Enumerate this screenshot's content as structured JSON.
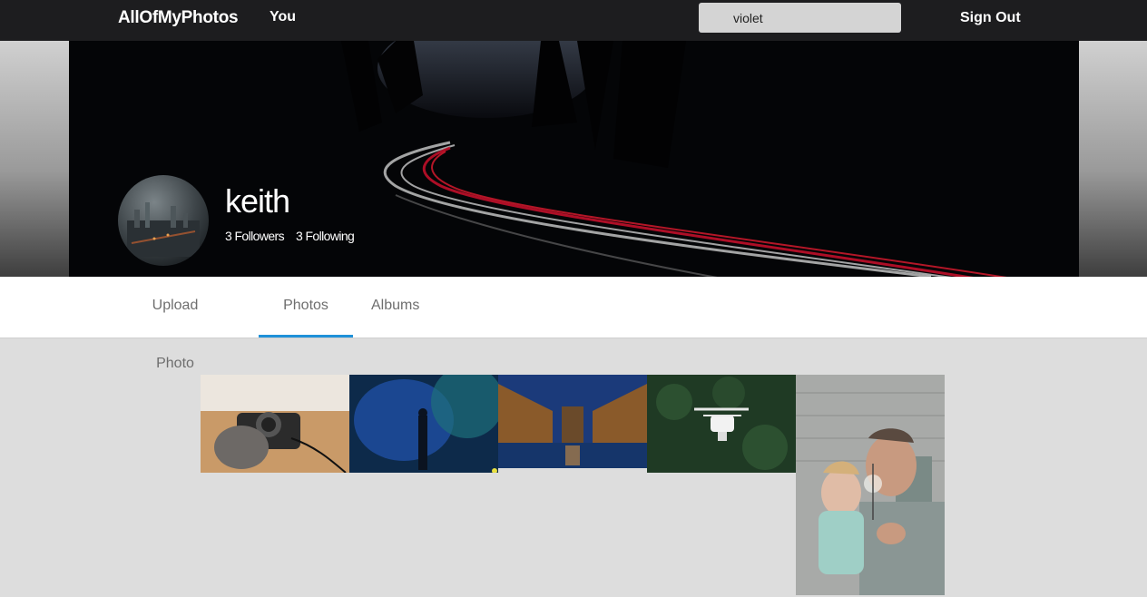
{
  "nav": {
    "brand": "AllOfMyPhotos",
    "you": "You",
    "search_value": "violet",
    "sign_out": "Sign Out"
  },
  "profile": {
    "username": "keith",
    "followers": "3 Followers",
    "following": "3 Following"
  },
  "tabs": [
    {
      "label": "Upload Photo",
      "active": false
    },
    {
      "label": "Photos",
      "active": true
    },
    {
      "label": "Albums",
      "active": false
    }
  ],
  "colors": {
    "nav_bg": "#1d1d1f",
    "accent": "#1f91d9",
    "page_bg": "#dddddd"
  },
  "photos": [
    {
      "subject": "camera-in-gloved-hand"
    },
    {
      "subject": "person-with-blue-smoke"
    },
    {
      "subject": "canal-city-at-dusk"
    },
    {
      "subject": "drone-over-forest"
    },
    {
      "subject": "man-holding-child-with-sparkler"
    }
  ]
}
